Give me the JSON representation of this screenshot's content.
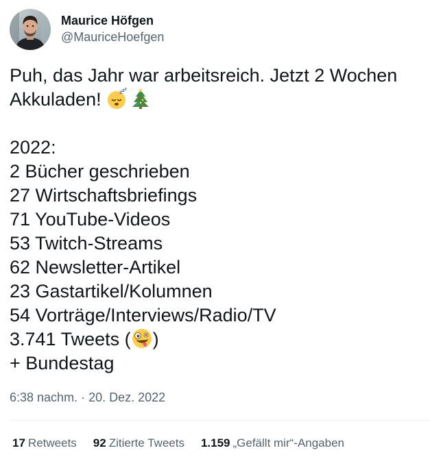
{
  "user": {
    "display_name": "Maurice Höfgen",
    "handle": "@MauriceHoefgen"
  },
  "tweet": {
    "line1": "Puh, das Jahr war arbeitsreich. Jetzt 2 Wochen",
    "line2": "Akkuladen!",
    "year_heading": "2022:",
    "items": [
      "2 Bücher geschrieben",
      "27 Wirtschaftsbriefings",
      "71 YouTube-Videos",
      "53 Twitch-Streams",
      "62 Newsletter-Artikel",
      "23 Gastartikel/Kolumnen",
      "54 Vorträge/Interviews/Radio/TV"
    ],
    "tweets_prefix": "3.741 Tweets (",
    "tweets_suffix": ")",
    "last_line": "+ Bundestag",
    "emojis": [
      "sleeping-face-emoji",
      "christmas-tree-emoji",
      "zany-face-emoji"
    ]
  },
  "timestamp": {
    "time": "6:38 nachm.",
    "separator": " · ",
    "date": "20. Dez. 2022"
  },
  "stats": {
    "retweets_count": "17",
    "retweets_label": "Retweets",
    "quotes_count": "92",
    "quotes_label": "Zitierte Tweets",
    "likes_count": "1.159",
    "likes_label": "„Gefällt mir“-Angaben"
  },
  "colors": {
    "text": "#0f1419",
    "secondary": "#536471",
    "divider": "#eff3f4"
  }
}
